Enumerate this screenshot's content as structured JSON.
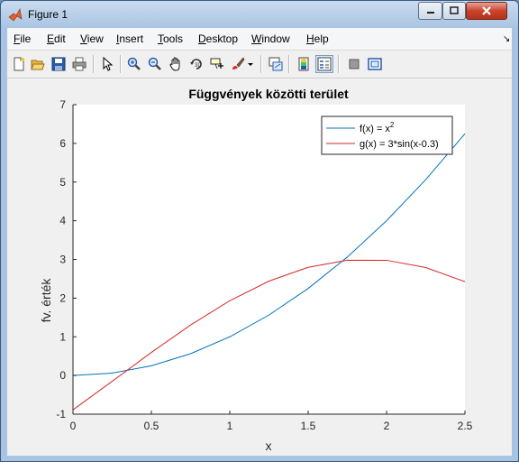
{
  "window": {
    "title": "Figure 1"
  },
  "menu": {
    "items": [
      {
        "label": "File",
        "u": "F",
        "rest": "ile"
      },
      {
        "label": "Edit",
        "u": "E",
        "rest": "dit"
      },
      {
        "label": "View",
        "u": "V",
        "rest": "iew"
      },
      {
        "label": "Insert",
        "u": "I",
        "rest": "nsert"
      },
      {
        "label": "Tools",
        "u": "T",
        "rest": "ools"
      },
      {
        "label": "Desktop",
        "u": "D",
        "rest": "esktop"
      },
      {
        "label": "Window",
        "u": "W",
        "rest": "indow"
      },
      {
        "label": "Help",
        "u": "H",
        "rest": "elp"
      }
    ]
  },
  "toolbar": {
    "icons": [
      "new-figure-icon",
      "open-file-icon",
      "save-icon",
      "print-icon",
      "edit-plot-arrow-icon",
      "zoom-in-icon",
      "zoom-out-icon",
      "pan-hand-icon",
      "rotate-3d-icon",
      "data-cursor-icon",
      "brush-icon",
      "brush-dropdown-icon",
      "link-plot-icon",
      "insert-colorbar-icon",
      "insert-legend-icon",
      "hide-plot-tools-icon",
      "show-plot-tools-icon"
    ]
  },
  "chart_data": {
    "type": "line",
    "title": "Függvények közötti terület",
    "xlabel": "x",
    "ylabel": "fv. érték",
    "xlim": [
      0,
      2.5
    ],
    "ylim": [
      -1,
      7
    ],
    "xticks": [
      "0",
      "0.5",
      "1",
      "1.5",
      "2",
      "2.5"
    ],
    "yticks": [
      "-1",
      "0",
      "1",
      "2",
      "3",
      "4",
      "5",
      "6",
      "7"
    ],
    "grid": false,
    "legend_position": "top-right",
    "series": [
      {
        "name": "f(x) = x²",
        "legend_base": "f(x) = x",
        "legend_sup": "2",
        "color": "#0072bd",
        "x": [
          0,
          0.25,
          0.5,
          0.75,
          1.0,
          1.25,
          1.5,
          1.75,
          2.0,
          2.25,
          2.5
        ],
        "y": [
          0,
          0.0625,
          0.25,
          0.5625,
          1.0,
          1.5625,
          2.25,
          3.0625,
          4.0,
          5.0625,
          6.25
        ]
      },
      {
        "name": "g(x) = 3*sin(x-0.3)",
        "color": "#d62728",
        "x": [
          0,
          0.25,
          0.5,
          0.75,
          1.0,
          1.25,
          1.5,
          1.75,
          2.0,
          2.25,
          2.5
        ],
        "y": [
          -0.887,
          -0.15,
          0.596,
          1.305,
          1.933,
          2.44,
          2.796,
          2.98,
          2.978,
          2.79,
          2.425
        ]
      }
    ]
  }
}
